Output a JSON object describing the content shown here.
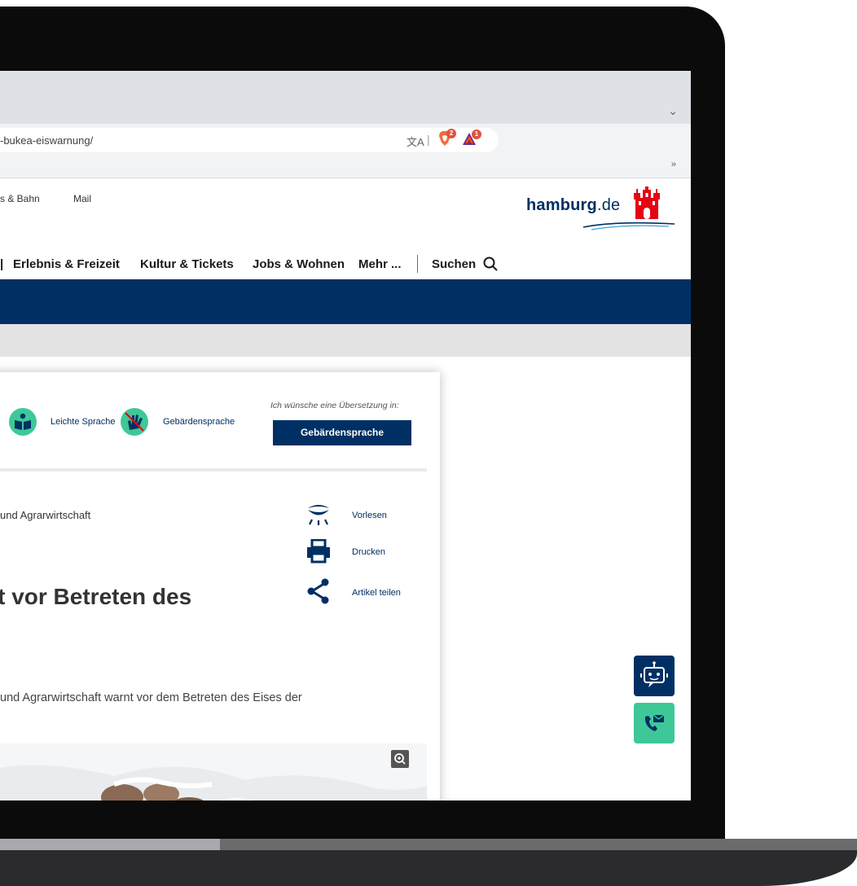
{
  "browser": {
    "url_fragment": "-bukea-eiswarnung/",
    "brave_badge": "2",
    "rewards_badge": "1",
    "bookmarks_more": "»"
  },
  "site_header": {
    "top_links": [
      "s & Bahn",
      "Mail"
    ],
    "logo": {
      "bold": "hamburg",
      "suffix": ".de"
    }
  },
  "main_nav": {
    "items": [
      "Erlebnis & Freizeit",
      "Kultur & Tickets",
      "Jobs & Wohnen",
      "Mehr ..."
    ],
    "search_label": "Suchen"
  },
  "accessibility": {
    "easy_language": "Leichte Sprache",
    "sign_language": "Gebärdensprache",
    "translation_prompt": "Ich wünsche eine Übersetzung in:",
    "translation_button": "Gebärdensprache"
  },
  "article": {
    "breadcrumb": "und Agrarwirtschaft",
    "headline": "nt vor Betreten des",
    "intro": "und Agrarwirtschaft warnt vor dem Betreten des Eises der"
  },
  "tools": {
    "read_aloud": "Vorlesen",
    "print": "Drucken",
    "share": "Artikel teilen"
  },
  "colors": {
    "brand_blue": "#003063",
    "accent_green": "#3ec898",
    "hamburg_red": "#e30613"
  }
}
